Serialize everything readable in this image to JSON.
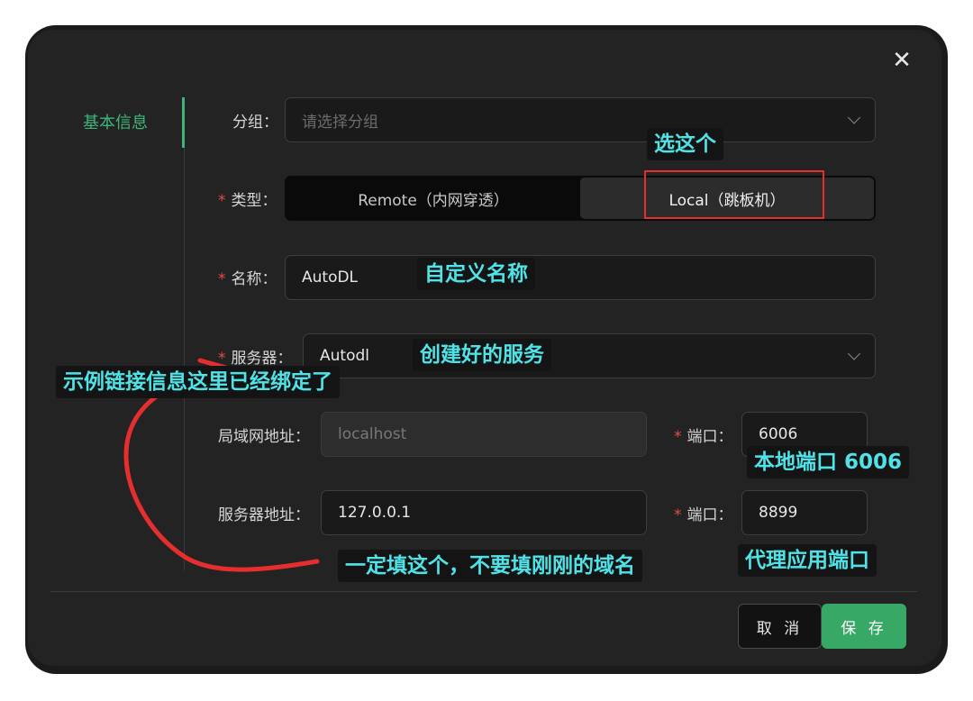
{
  "dialog": {
    "close_icon": "close-icon",
    "side_tab": "基本信息",
    "fields": {
      "group": {
        "label": "分组",
        "placeholder": "请选择分组"
      },
      "type": {
        "label": "类型",
        "options": [
          "Remote（内网穿透）",
          "Local（跳板机）"
        ],
        "selected": "Local（跳板机）"
      },
      "name": {
        "label": "名称",
        "value": "AutoDL"
      },
      "server": {
        "label": "服务器",
        "value": "Autodl"
      },
      "lan_address": {
        "label": "局域网地址",
        "placeholder": "localhost"
      },
      "lan_port": {
        "label": "端口",
        "value": "6006"
      },
      "server_address": {
        "label": "服务器地址",
        "value": "127.0.0.1"
      },
      "server_port": {
        "label": "端口",
        "value": "8899"
      }
    },
    "buttons": {
      "cancel": "取 消",
      "save": "保 存"
    }
  },
  "annotations": {
    "pick_this": "选这个",
    "custom_name": "自定义名称",
    "created_service": "创建好的服务",
    "example_note": "示例链接信息这里已经绑定了",
    "local_port": "本地端口 6006",
    "must_fill": "一定填这个，不要填刚刚的域名",
    "proxy_port": "代理应用端口"
  },
  "colors": {
    "accent": "#38a867",
    "required": "#e34b4b",
    "annotation_text": "#4fe3e8",
    "annotation_mark": "#e62e2e"
  }
}
